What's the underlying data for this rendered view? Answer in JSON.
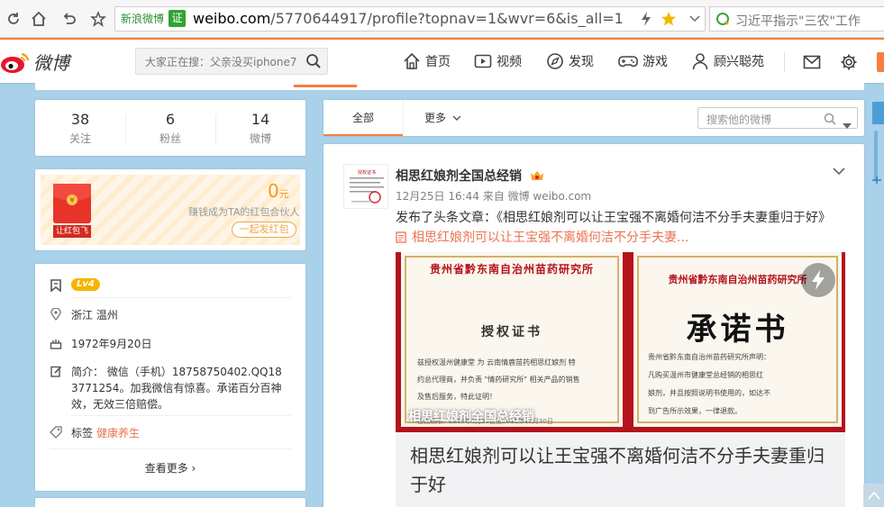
{
  "browser": {
    "site_name": "新浪微博",
    "cert_badge": "证",
    "url_domain": "weibo.com",
    "url_path": "/5770644917/profile?topnav=1&wvr=6&is_all=1",
    "search_text": "习近平指示\"三农\"工作"
  },
  "topnav": {
    "logo_text": "微博",
    "hot_search_placeholder": "大家正在搜：父亲没买iphone7",
    "items": [
      "首页",
      "视频",
      "发现",
      "游戏",
      "顾兴聪苑"
    ]
  },
  "stats": [
    {
      "value": "38",
      "label": "关注"
    },
    {
      "value": "6",
      "label": "粉丝"
    },
    {
      "value": "14",
      "label": "微博"
    }
  ],
  "redpack": {
    "amount": "0",
    "unit": "元",
    "desc": "赚钱成为TA的红包合伙人",
    "button": "一起发红包",
    "icon_label": "让红包飞"
  },
  "profile": {
    "level": "Lv4",
    "location": "浙江 温州",
    "birthday": "1972年9月20日",
    "bio": "简介： 微信（手机）18758750402.QQ183771254。加我微信有惊喜。承诺百分百神效，无效三倍赔偿。",
    "tag_label": "标签",
    "tag_value": "健康养生",
    "more": "查看更多 ›"
  },
  "feed": {
    "tab_all": "全部",
    "tab_more": "更多",
    "search_placeholder": "搜索他的微博"
  },
  "post": {
    "author": "相思红娘剂全国总经销",
    "meta": "12月25日 16:44 来自 微博 weibo.com",
    "text": "发布了头条文章：《相思红娘剂可以让王宝强不离婚何洁不分手夫妻重归于好》",
    "link_text": "相思红娘剂可以让王宝强不离婚何洁不分手夫妻...",
    "article_title": "相思红娘剂可以让王宝强不离婚何洁不分手夫妻重归于好",
    "image_overlay": "相思红娘剂全国总经销"
  },
  "certificate_left": {
    "header": "贵州省黔东南自治州苗药研究所",
    "title": "授权证书",
    "body_lines": [
      "兹授权温州健康堂 为 云南情鹿苗药相思红娘剂 特",
      "约总代理商，并负责 \"情药研究所\" 相关产品的销售",
      "及售后服务，特此证明！"
    ],
    "footer": "授权期限：2013年3月27日至2016年12月30日"
  },
  "certificate_right": {
    "header": "贵州省黔东南自治州苗药研究所",
    "title": "承诺书",
    "body_lines": [
      "贵州省黔东南自治州苗药研究所声明：",
      "  凡购买温州市健康堂总经销的相思红",
      "娘剂，并且按照说明书使用的，如达不",
      "到广告所示效果，一律退款。"
    ]
  },
  "colors": {
    "accent": "#fa7d3c",
    "link": "#eb7350",
    "background": "#a9d1ea",
    "cert_red": "#b5121b"
  }
}
